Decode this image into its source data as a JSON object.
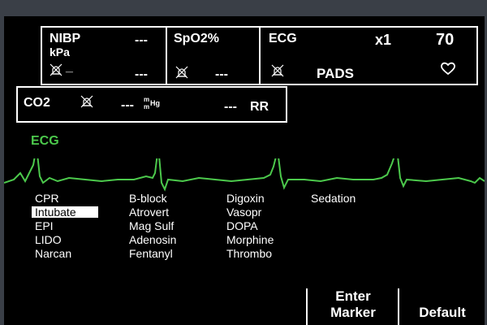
{
  "nibp": {
    "label": "NIBP",
    "unit": "kPa",
    "value_top": "---",
    "value_bottom": "---",
    "dash": "_"
  },
  "spo2": {
    "label": "SpO2%",
    "value_top": "---",
    "value_bottom": "---"
  },
  "ecg_panel": {
    "label": "ECG",
    "gain": "x1",
    "heart_rate": "70",
    "source": "PADS"
  },
  "co2": {
    "label": "CO2",
    "value": "---",
    "unit_top": "m",
    "unit_bottom": "m",
    "unit_hg": "Hg",
    "rr_value": "---",
    "rr_label": "RR"
  },
  "waveform": {
    "label": "ECG",
    "color": "#4cc94c"
  },
  "menu": {
    "col1": [
      "CPR",
      "Intubate",
      "EPI",
      "LIDO",
      "Narcan"
    ],
    "col2": [
      "B-block",
      "Atrovert",
      "Mag Sulf",
      "Adenosin",
      "Fentanyl"
    ],
    "col3": [
      "Digoxin",
      "Vasopr",
      "DOPA",
      "Morphine",
      "Thrombo"
    ],
    "col4": [
      "Sedation"
    ],
    "selected": "Intubate"
  },
  "softkeys": {
    "enter_line1": "Enter",
    "enter_line2": "Marker",
    "default": "Default"
  },
  "colors": {
    "background": "#000000",
    "text": "#ffffff",
    "ecg": "#4cc94c",
    "frame": "#3a3f47"
  },
  "icons": {
    "alarm_off": "alarm-off-icon",
    "heart": "heart-icon"
  }
}
